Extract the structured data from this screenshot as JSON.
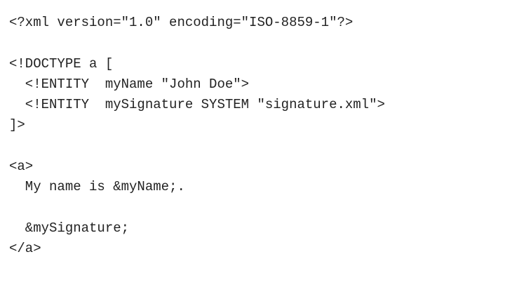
{
  "code": {
    "lines": [
      "<?xml version=\"1.0\" encoding=\"ISO-8859-1\"?>",
      "",
      "<!DOCTYPE a [",
      "  <!ENTITY  myName \"John Doe\">",
      "  <!ENTITY  mySignature SYSTEM \"signature.xml\">",
      "]>",
      "",
      "<a>",
      "  My name is &myName;.",
      "",
      "  &mySignature;",
      "</a>"
    ]
  }
}
